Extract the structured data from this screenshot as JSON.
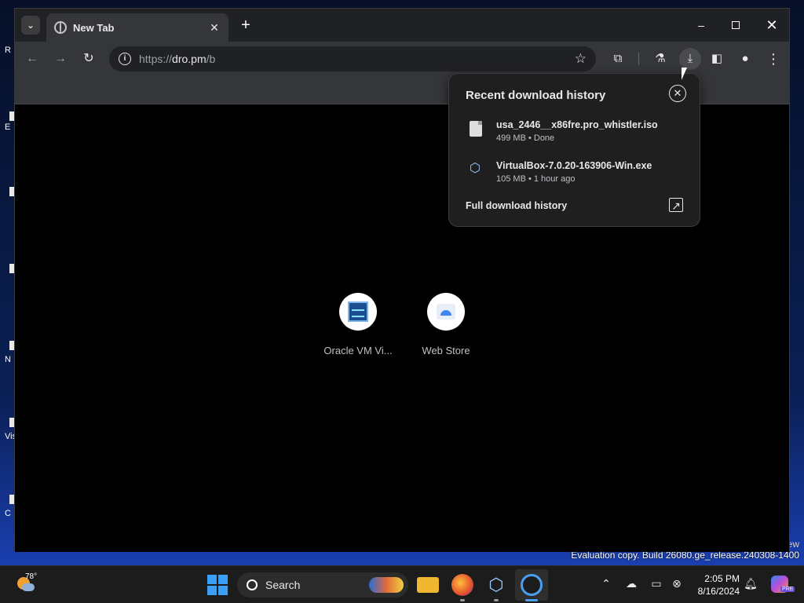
{
  "browser": {
    "tab": {
      "title": "New Tab"
    },
    "window_controls": {
      "minimize": "–",
      "close": "✕"
    },
    "toolbar": {
      "url_scheme": "https://",
      "url_host": "dro.pm",
      "url_path": "/b"
    }
  },
  "download_popup": {
    "title": "Recent download history",
    "items": [
      {
        "name": "usa_2446__x86fre.pro_whistler.iso",
        "meta": "499 MB • Done",
        "icon": "file-icon"
      },
      {
        "name": "VirtualBox-7.0.20-163906-Win.exe",
        "meta": "105 MB • 1 hour ago",
        "icon": "virtualbox-icon"
      }
    ],
    "full_history_label": "Full download history"
  },
  "shortcuts": [
    {
      "label": "Oracle VM Vi...",
      "icon": "oracle-vm-icon"
    },
    {
      "label": "Web Store",
      "icon": "web-store-icon"
    }
  ],
  "desktop": {
    "icon_labels": [
      "R",
      "E",
      "",
      "N",
      "Vis",
      "C"
    ],
    "watermark_line1": "ew",
    "watermark_line2": "Evaluation copy. Build 26080.ge_release.240308-1400"
  },
  "taskbar": {
    "weather_temp": "78°",
    "search_label": "Search",
    "time": "2:05 PM",
    "date": "8/16/2024",
    "copilot_badge": "PRE",
    "apps": [
      "file-explorer-icon",
      "firefox-icon",
      "virtualbox-icon",
      "chrome-icon"
    ],
    "tray_icons": [
      "chevron-up-icon",
      "onedrive-icon",
      "network-icon",
      "volume-muted-icon",
      "bell-icon"
    ]
  },
  "colors": {
    "browser_frame": "#202124",
    "toolbar": "#35363a",
    "popup_bg": "#1f1f1f",
    "accent": "#4aa0f0"
  }
}
